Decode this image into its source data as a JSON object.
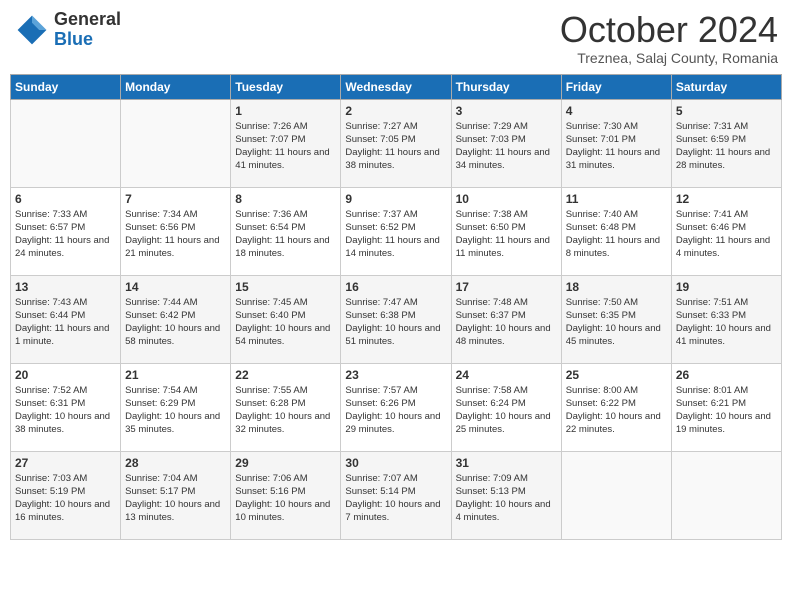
{
  "header": {
    "logo_general": "General",
    "logo_blue": "Blue",
    "month_title": "October 2024",
    "location": "Treznea, Salaj County, Romania"
  },
  "weekdays": [
    "Sunday",
    "Monday",
    "Tuesday",
    "Wednesday",
    "Thursday",
    "Friday",
    "Saturday"
  ],
  "weeks": [
    [
      {
        "day": "",
        "info": ""
      },
      {
        "day": "",
        "info": ""
      },
      {
        "day": "1",
        "info": "Sunrise: 7:26 AM\nSunset: 7:07 PM\nDaylight: 11 hours and 41 minutes."
      },
      {
        "day": "2",
        "info": "Sunrise: 7:27 AM\nSunset: 7:05 PM\nDaylight: 11 hours and 38 minutes."
      },
      {
        "day": "3",
        "info": "Sunrise: 7:29 AM\nSunset: 7:03 PM\nDaylight: 11 hours and 34 minutes."
      },
      {
        "day": "4",
        "info": "Sunrise: 7:30 AM\nSunset: 7:01 PM\nDaylight: 11 hours and 31 minutes."
      },
      {
        "day": "5",
        "info": "Sunrise: 7:31 AM\nSunset: 6:59 PM\nDaylight: 11 hours and 28 minutes."
      }
    ],
    [
      {
        "day": "6",
        "info": "Sunrise: 7:33 AM\nSunset: 6:57 PM\nDaylight: 11 hours and 24 minutes."
      },
      {
        "day": "7",
        "info": "Sunrise: 7:34 AM\nSunset: 6:56 PM\nDaylight: 11 hours and 21 minutes."
      },
      {
        "day": "8",
        "info": "Sunrise: 7:36 AM\nSunset: 6:54 PM\nDaylight: 11 hours and 18 minutes."
      },
      {
        "day": "9",
        "info": "Sunrise: 7:37 AM\nSunset: 6:52 PM\nDaylight: 11 hours and 14 minutes."
      },
      {
        "day": "10",
        "info": "Sunrise: 7:38 AM\nSunset: 6:50 PM\nDaylight: 11 hours and 11 minutes."
      },
      {
        "day": "11",
        "info": "Sunrise: 7:40 AM\nSunset: 6:48 PM\nDaylight: 11 hours and 8 minutes."
      },
      {
        "day": "12",
        "info": "Sunrise: 7:41 AM\nSunset: 6:46 PM\nDaylight: 11 hours and 4 minutes."
      }
    ],
    [
      {
        "day": "13",
        "info": "Sunrise: 7:43 AM\nSunset: 6:44 PM\nDaylight: 11 hours and 1 minute."
      },
      {
        "day": "14",
        "info": "Sunrise: 7:44 AM\nSunset: 6:42 PM\nDaylight: 10 hours and 58 minutes."
      },
      {
        "day": "15",
        "info": "Sunrise: 7:45 AM\nSunset: 6:40 PM\nDaylight: 10 hours and 54 minutes."
      },
      {
        "day": "16",
        "info": "Sunrise: 7:47 AM\nSunset: 6:38 PM\nDaylight: 10 hours and 51 minutes."
      },
      {
        "day": "17",
        "info": "Sunrise: 7:48 AM\nSunset: 6:37 PM\nDaylight: 10 hours and 48 minutes."
      },
      {
        "day": "18",
        "info": "Sunrise: 7:50 AM\nSunset: 6:35 PM\nDaylight: 10 hours and 45 minutes."
      },
      {
        "day": "19",
        "info": "Sunrise: 7:51 AM\nSunset: 6:33 PM\nDaylight: 10 hours and 41 minutes."
      }
    ],
    [
      {
        "day": "20",
        "info": "Sunrise: 7:52 AM\nSunset: 6:31 PM\nDaylight: 10 hours and 38 minutes."
      },
      {
        "day": "21",
        "info": "Sunrise: 7:54 AM\nSunset: 6:29 PM\nDaylight: 10 hours and 35 minutes."
      },
      {
        "day": "22",
        "info": "Sunrise: 7:55 AM\nSunset: 6:28 PM\nDaylight: 10 hours and 32 minutes."
      },
      {
        "day": "23",
        "info": "Sunrise: 7:57 AM\nSunset: 6:26 PM\nDaylight: 10 hours and 29 minutes."
      },
      {
        "day": "24",
        "info": "Sunrise: 7:58 AM\nSunset: 6:24 PM\nDaylight: 10 hours and 25 minutes."
      },
      {
        "day": "25",
        "info": "Sunrise: 8:00 AM\nSunset: 6:22 PM\nDaylight: 10 hours and 22 minutes."
      },
      {
        "day": "26",
        "info": "Sunrise: 8:01 AM\nSunset: 6:21 PM\nDaylight: 10 hours and 19 minutes."
      }
    ],
    [
      {
        "day": "27",
        "info": "Sunrise: 7:03 AM\nSunset: 5:19 PM\nDaylight: 10 hours and 16 minutes."
      },
      {
        "day": "28",
        "info": "Sunrise: 7:04 AM\nSunset: 5:17 PM\nDaylight: 10 hours and 13 minutes."
      },
      {
        "day": "29",
        "info": "Sunrise: 7:06 AM\nSunset: 5:16 PM\nDaylight: 10 hours and 10 minutes."
      },
      {
        "day": "30",
        "info": "Sunrise: 7:07 AM\nSunset: 5:14 PM\nDaylight: 10 hours and 7 minutes."
      },
      {
        "day": "31",
        "info": "Sunrise: 7:09 AM\nSunset: 5:13 PM\nDaylight: 10 hours and 4 minutes."
      },
      {
        "day": "",
        "info": ""
      },
      {
        "day": "",
        "info": ""
      }
    ]
  ]
}
